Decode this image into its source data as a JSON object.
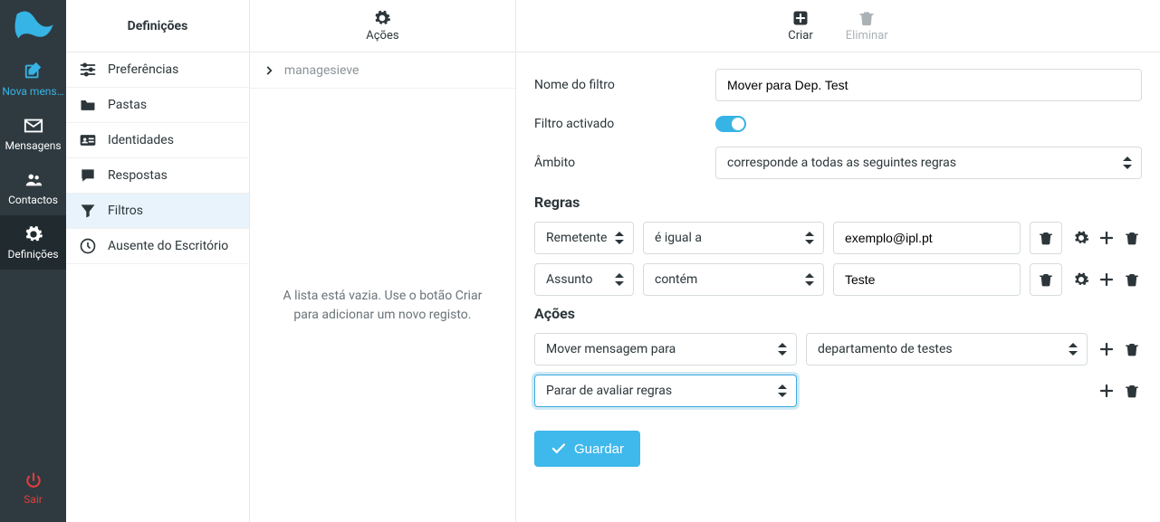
{
  "rail": {
    "compose": "Nova mens…",
    "messages": "Mensagens",
    "contacts": "Contactos",
    "settings": "Definições",
    "logout": "Sair"
  },
  "sidebar": {
    "title": "Definições",
    "items": {
      "prefs": "Preferências",
      "folders": "Pastas",
      "identities": "Identidades",
      "responses": "Respostas",
      "filters": "Filtros",
      "ooo": "Ausente do Escritório"
    }
  },
  "mid": {
    "actions_label": "Ações",
    "breadcrumb": "managesieve",
    "empty": "A lista está vazia. Use o botão Criar para adicionar um novo registo."
  },
  "toolbar": {
    "create": "Criar",
    "delete": "Eliminar"
  },
  "form": {
    "name_label": "Nome do filtro",
    "name_value": "Mover para Dep. Test",
    "enabled_label": "Filtro activado",
    "scope_label": "Âmbito",
    "scope_value": "corresponde a todas as seguintes regras",
    "rules_heading": "Regras",
    "actions_heading": "Ações",
    "rules": [
      {
        "field": "Remetente",
        "op": "é igual a",
        "value": "exemplo@ipl.pt"
      },
      {
        "field": "Assunto",
        "op": "contém",
        "value": "Teste"
      }
    ],
    "actions": [
      {
        "type": "Mover mensagem para",
        "target": "departamento de testes"
      },
      {
        "type": "Parar de avaliar regras"
      }
    ],
    "save": "Guardar"
  }
}
